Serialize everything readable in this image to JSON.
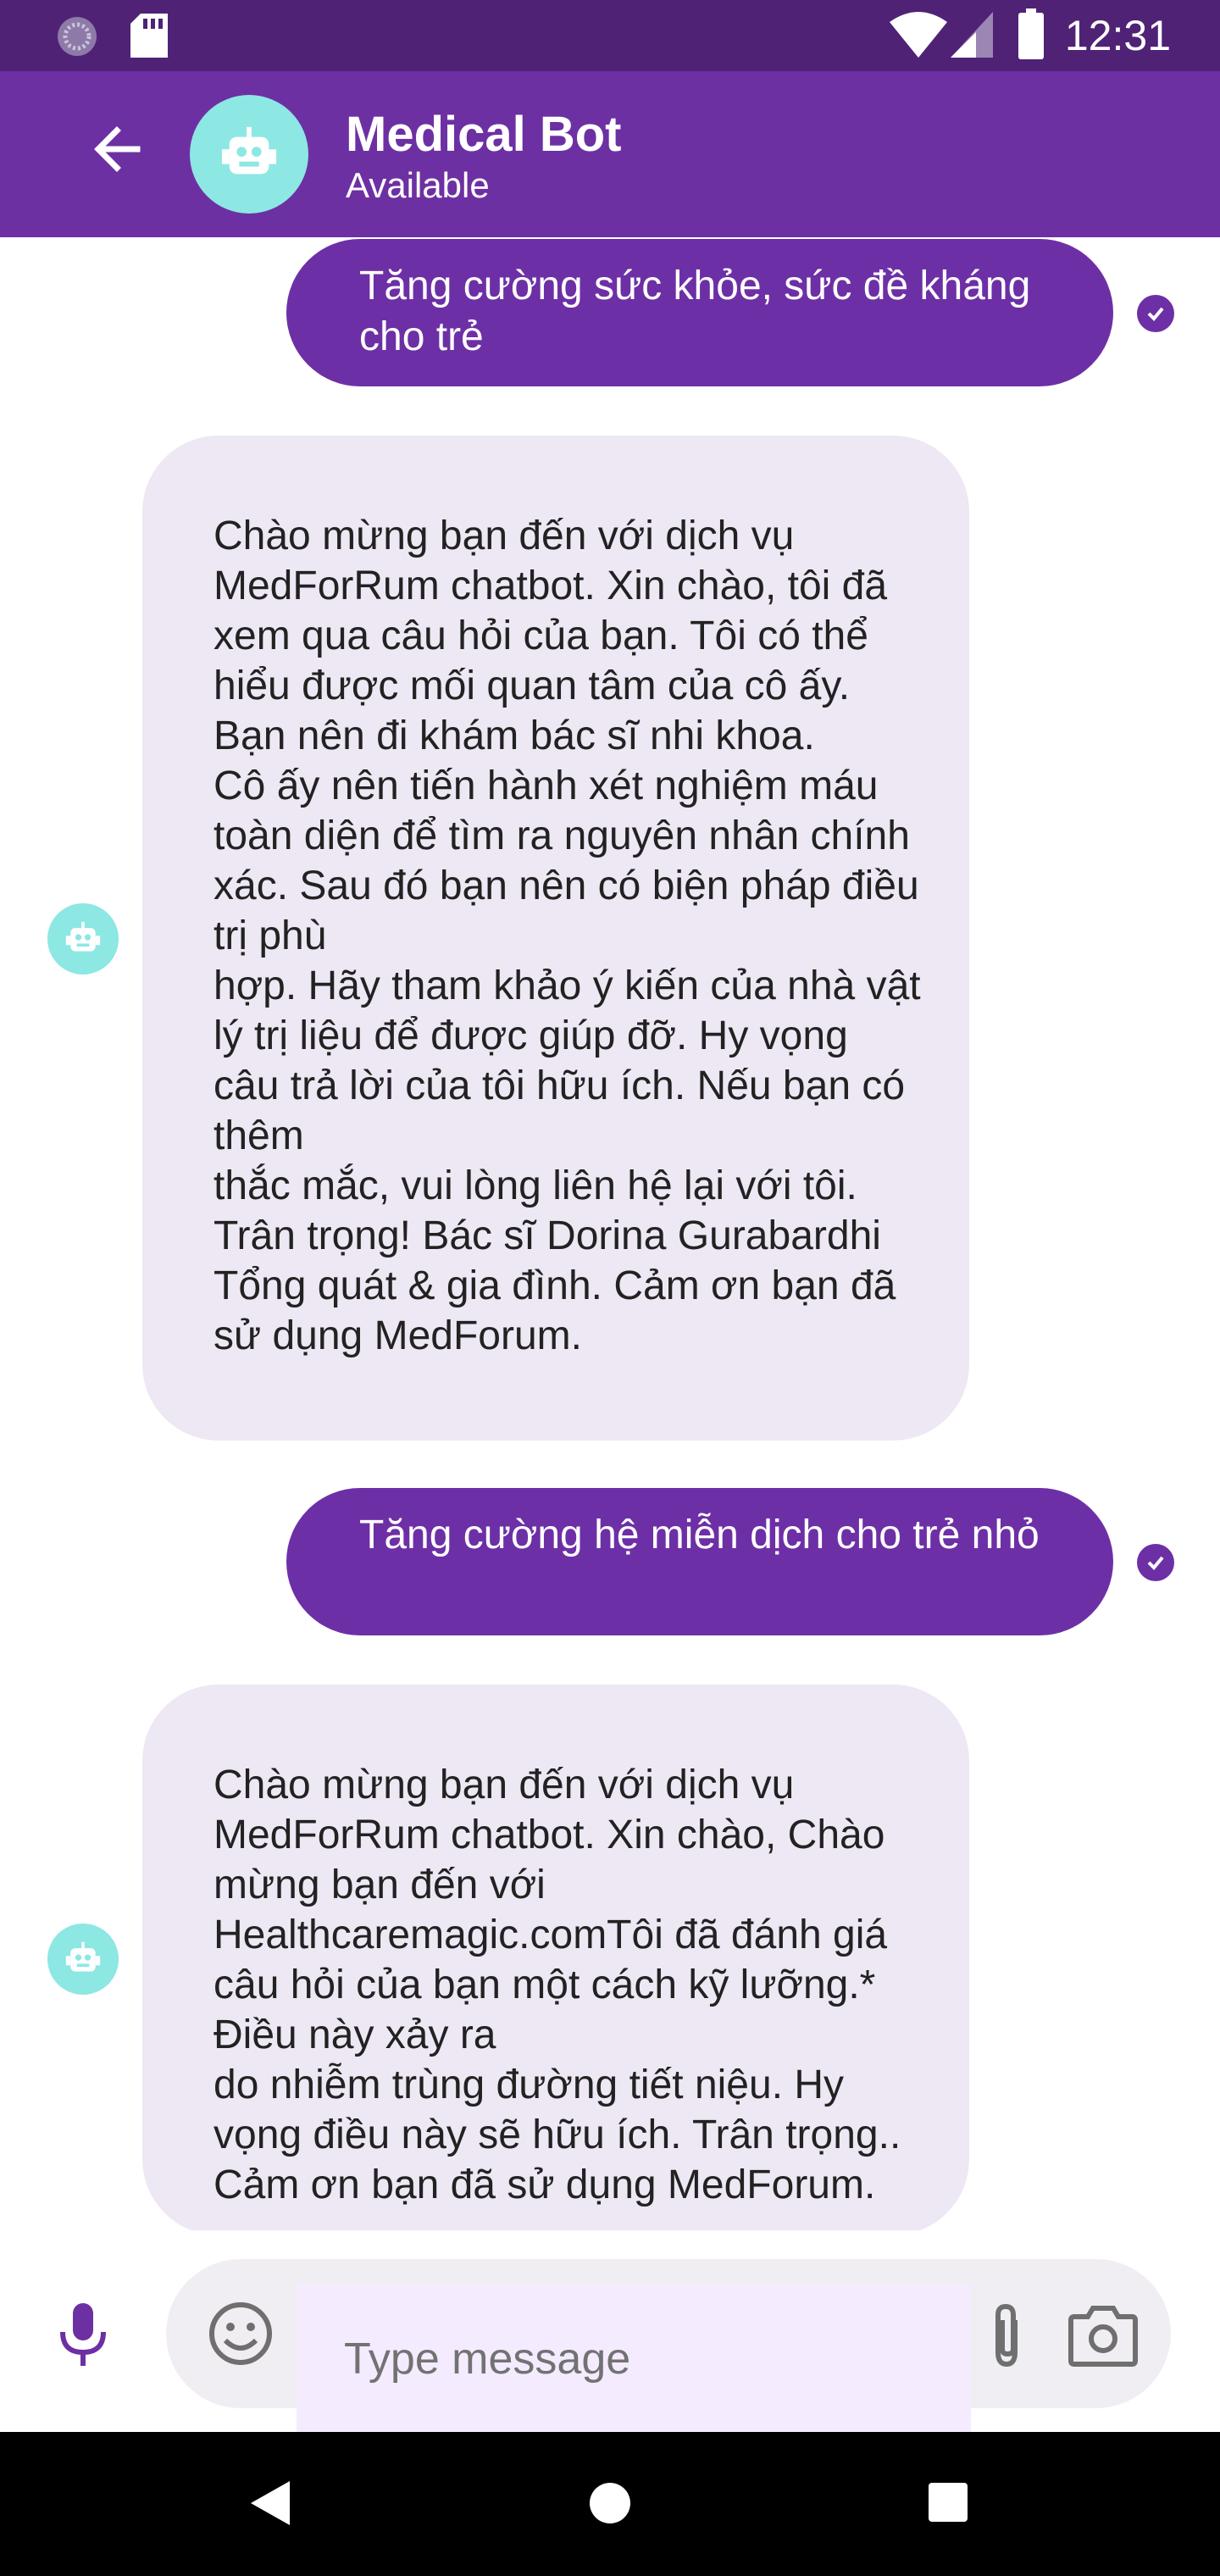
{
  "status_bar": {
    "time": "12:31"
  },
  "header": {
    "title": "Medical Bot",
    "status": "Available"
  },
  "messages": [
    {
      "from": "user",
      "text": "Tăng cường sức khỏe, sức đề kháng cho trẻ",
      "status": "sent"
    },
    {
      "from": "bot",
      "text": "Chào mừng bạn đến với dịch vụ MedForRum chatbot. Xin chào, tôi đã xem qua câu hỏi của bạn. Tôi có thể hiểu được mối quan tâm của cô ấy. Bạn nên đi khám bác sĩ nhi khoa.\nCô ấy nên tiến hành xét nghiệm máu toàn diện để tìm ra nguyên nhân chính xác. Sau đó bạn nên có biện pháp điều trị phù\nhợp. Hãy tham khảo ý kiến của nhà vật lý trị liệu để được giúp đỡ. Hy vọng câu trả lời của tôi hữu ích. Nếu bạn có thêm\nthắc mắc, vui lòng liên hệ lại với tôi. Trân trọng! Bác sĩ Dorina Gurabardhi Tổng quát & gia đình. Cảm ơn bạn đã sử dụng MedForum."
    },
    {
      "from": "user",
      "text": "Tăng cường hệ miễn dịch cho trẻ nhỏ",
      "status": "sent"
    },
    {
      "from": "bot",
      "text": "Chào mừng bạn đến với dịch vụ MedForRum chatbot. Xin chào, Chào mừng bạn đến với Healthcaremagic.comTôi đã đánh giá câu hỏi của bạn một cách kỹ lưỡng.* Điều này xảy ra\ndo nhiễm trùng đường tiết niệu. Hy vọng điều này sẽ hữu ích. Trân trọng.. Cảm ơn bạn đã sử dụng MedForum."
    }
  ],
  "composer": {
    "placeholder": "Type message"
  },
  "colors": {
    "primary": "#6d30a3",
    "status_bar": "#4f2276",
    "avatar": "#8de7e3",
    "bot_bubble": "#ede8f3",
    "input_highlight": "#f4ebff"
  },
  "icons": [
    "back-arrow-icon",
    "robot-icon",
    "check-icon",
    "mic-icon",
    "emoji-icon",
    "attach-icon",
    "camera-icon",
    "nav-back-icon",
    "nav-home-icon",
    "nav-recents-icon",
    "wifi-icon",
    "signal-icon",
    "battery-icon",
    "sd-card-icon"
  ]
}
